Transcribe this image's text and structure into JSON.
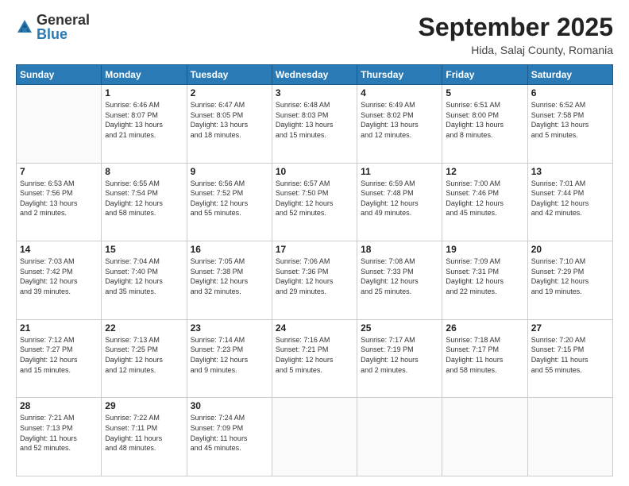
{
  "header": {
    "logo_general": "General",
    "logo_blue": "Blue",
    "month": "September 2025",
    "location": "Hida, Salaj County, Romania"
  },
  "weekdays": [
    "Sunday",
    "Monday",
    "Tuesday",
    "Wednesday",
    "Thursday",
    "Friday",
    "Saturday"
  ],
  "weeks": [
    [
      {
        "day": "",
        "lines": []
      },
      {
        "day": "1",
        "lines": [
          "Sunrise: 6:46 AM",
          "Sunset: 8:07 PM",
          "Daylight: 13 hours",
          "and 21 minutes."
        ]
      },
      {
        "day": "2",
        "lines": [
          "Sunrise: 6:47 AM",
          "Sunset: 8:05 PM",
          "Daylight: 13 hours",
          "and 18 minutes."
        ]
      },
      {
        "day": "3",
        "lines": [
          "Sunrise: 6:48 AM",
          "Sunset: 8:03 PM",
          "Daylight: 13 hours",
          "and 15 minutes."
        ]
      },
      {
        "day": "4",
        "lines": [
          "Sunrise: 6:49 AM",
          "Sunset: 8:02 PM",
          "Daylight: 13 hours",
          "and 12 minutes."
        ]
      },
      {
        "day": "5",
        "lines": [
          "Sunrise: 6:51 AM",
          "Sunset: 8:00 PM",
          "Daylight: 13 hours",
          "and 8 minutes."
        ]
      },
      {
        "day": "6",
        "lines": [
          "Sunrise: 6:52 AM",
          "Sunset: 7:58 PM",
          "Daylight: 13 hours",
          "and 5 minutes."
        ]
      }
    ],
    [
      {
        "day": "7",
        "lines": [
          "Sunrise: 6:53 AM",
          "Sunset: 7:56 PM",
          "Daylight: 13 hours",
          "and 2 minutes."
        ]
      },
      {
        "day": "8",
        "lines": [
          "Sunrise: 6:55 AM",
          "Sunset: 7:54 PM",
          "Daylight: 12 hours",
          "and 58 minutes."
        ]
      },
      {
        "day": "9",
        "lines": [
          "Sunrise: 6:56 AM",
          "Sunset: 7:52 PM",
          "Daylight: 12 hours",
          "and 55 minutes."
        ]
      },
      {
        "day": "10",
        "lines": [
          "Sunrise: 6:57 AM",
          "Sunset: 7:50 PM",
          "Daylight: 12 hours",
          "and 52 minutes."
        ]
      },
      {
        "day": "11",
        "lines": [
          "Sunrise: 6:59 AM",
          "Sunset: 7:48 PM",
          "Daylight: 12 hours",
          "and 49 minutes."
        ]
      },
      {
        "day": "12",
        "lines": [
          "Sunrise: 7:00 AM",
          "Sunset: 7:46 PM",
          "Daylight: 12 hours",
          "and 45 minutes."
        ]
      },
      {
        "day": "13",
        "lines": [
          "Sunrise: 7:01 AM",
          "Sunset: 7:44 PM",
          "Daylight: 12 hours",
          "and 42 minutes."
        ]
      }
    ],
    [
      {
        "day": "14",
        "lines": [
          "Sunrise: 7:03 AM",
          "Sunset: 7:42 PM",
          "Daylight: 12 hours",
          "and 39 minutes."
        ]
      },
      {
        "day": "15",
        "lines": [
          "Sunrise: 7:04 AM",
          "Sunset: 7:40 PM",
          "Daylight: 12 hours",
          "and 35 minutes."
        ]
      },
      {
        "day": "16",
        "lines": [
          "Sunrise: 7:05 AM",
          "Sunset: 7:38 PM",
          "Daylight: 12 hours",
          "and 32 minutes."
        ]
      },
      {
        "day": "17",
        "lines": [
          "Sunrise: 7:06 AM",
          "Sunset: 7:36 PM",
          "Daylight: 12 hours",
          "and 29 minutes."
        ]
      },
      {
        "day": "18",
        "lines": [
          "Sunrise: 7:08 AM",
          "Sunset: 7:33 PM",
          "Daylight: 12 hours",
          "and 25 minutes."
        ]
      },
      {
        "day": "19",
        "lines": [
          "Sunrise: 7:09 AM",
          "Sunset: 7:31 PM",
          "Daylight: 12 hours",
          "and 22 minutes."
        ]
      },
      {
        "day": "20",
        "lines": [
          "Sunrise: 7:10 AM",
          "Sunset: 7:29 PM",
          "Daylight: 12 hours",
          "and 19 minutes."
        ]
      }
    ],
    [
      {
        "day": "21",
        "lines": [
          "Sunrise: 7:12 AM",
          "Sunset: 7:27 PM",
          "Daylight: 12 hours",
          "and 15 minutes."
        ]
      },
      {
        "day": "22",
        "lines": [
          "Sunrise: 7:13 AM",
          "Sunset: 7:25 PM",
          "Daylight: 12 hours",
          "and 12 minutes."
        ]
      },
      {
        "day": "23",
        "lines": [
          "Sunrise: 7:14 AM",
          "Sunset: 7:23 PM",
          "Daylight: 12 hours",
          "and 9 minutes."
        ]
      },
      {
        "day": "24",
        "lines": [
          "Sunrise: 7:16 AM",
          "Sunset: 7:21 PM",
          "Daylight: 12 hours",
          "and 5 minutes."
        ]
      },
      {
        "day": "25",
        "lines": [
          "Sunrise: 7:17 AM",
          "Sunset: 7:19 PM",
          "Daylight: 12 hours",
          "and 2 minutes."
        ]
      },
      {
        "day": "26",
        "lines": [
          "Sunrise: 7:18 AM",
          "Sunset: 7:17 PM",
          "Daylight: 11 hours",
          "and 58 minutes."
        ]
      },
      {
        "day": "27",
        "lines": [
          "Sunrise: 7:20 AM",
          "Sunset: 7:15 PM",
          "Daylight: 11 hours",
          "and 55 minutes."
        ]
      }
    ],
    [
      {
        "day": "28",
        "lines": [
          "Sunrise: 7:21 AM",
          "Sunset: 7:13 PM",
          "Daylight: 11 hours",
          "and 52 minutes."
        ]
      },
      {
        "day": "29",
        "lines": [
          "Sunrise: 7:22 AM",
          "Sunset: 7:11 PM",
          "Daylight: 11 hours",
          "and 48 minutes."
        ]
      },
      {
        "day": "30",
        "lines": [
          "Sunrise: 7:24 AM",
          "Sunset: 7:09 PM",
          "Daylight: 11 hours",
          "and 45 minutes."
        ]
      },
      {
        "day": "",
        "lines": []
      },
      {
        "day": "",
        "lines": []
      },
      {
        "day": "",
        "lines": []
      },
      {
        "day": "",
        "lines": []
      }
    ]
  ]
}
